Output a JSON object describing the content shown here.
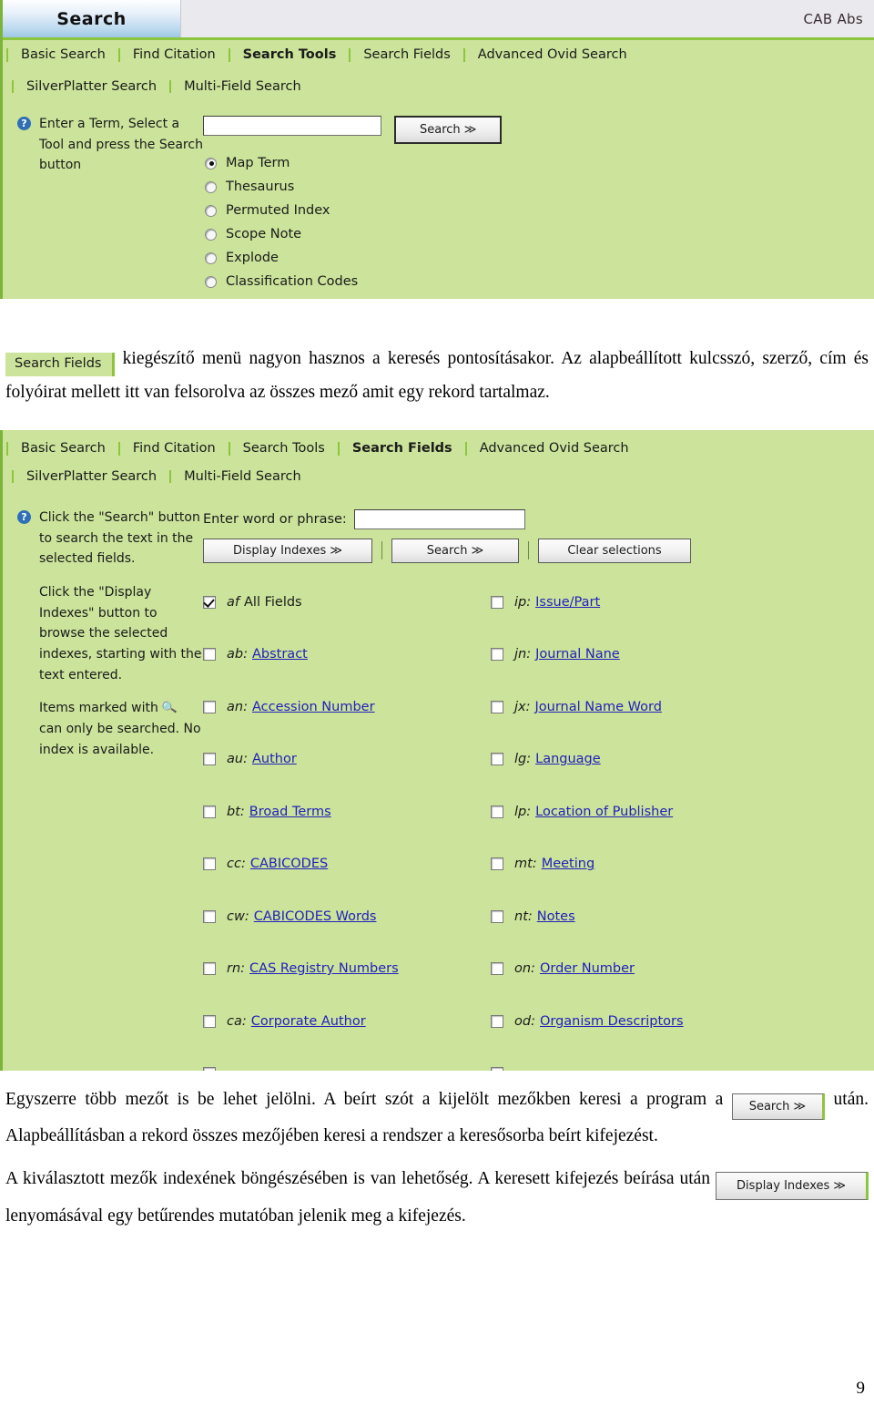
{
  "colors": {
    "panel_green": "#cbe39a",
    "accent_green": "#8cc63f",
    "link_blue": "#2222bb",
    "tab_blue": "#9ec7e6"
  },
  "screenshot1": {
    "window_tab_label": "Search",
    "database_label": "CAB Abs",
    "tabs_row1": [
      {
        "label": "Basic Search",
        "active": false
      },
      {
        "label": "Find Citation",
        "active": false
      },
      {
        "label": "Search Tools",
        "active": true
      },
      {
        "label": "Search Fields",
        "active": false
      },
      {
        "label": "Advanced Ovid Search",
        "active": false
      }
    ],
    "tabs_row2": [
      {
        "label": "SilverPlatter Search",
        "active": false
      },
      {
        "label": "Multi-Field Search",
        "active": false
      }
    ],
    "help_icon": "question-mark-icon",
    "help_text": "Enter a Term, Select a Tool and press the Search button",
    "term_input_value": "",
    "search_button_label": "Search ≫",
    "tools": [
      {
        "label": "Map Term",
        "selected": true
      },
      {
        "label": "Thesaurus",
        "selected": false
      },
      {
        "label": "Permuted Index",
        "selected": false
      },
      {
        "label": "Scope Note",
        "selected": false
      },
      {
        "label": "Explode",
        "selected": false
      },
      {
        "label": "Classification Codes",
        "selected": false
      }
    ]
  },
  "paragraph1": {
    "chip_label": "Search Fields",
    "text": " kiegészítő menü nagyon hasznos a keresés pontosításakor. Az alapbeállított kulcsszó, szerző, cím és folyóirat mellett itt van felsorolva az összes mező amit egy rekord tartalmaz."
  },
  "screenshot2": {
    "tabs_row1": [
      {
        "label": "Basic Search",
        "active": false
      },
      {
        "label": "Find Citation",
        "active": false
      },
      {
        "label": "Search Tools",
        "active": false
      },
      {
        "label": "Search Fields",
        "active": true
      },
      {
        "label": "Advanced Ovid Search",
        "active": false
      }
    ],
    "tabs_row2": [
      {
        "label": "SilverPlatter Search",
        "active": false
      },
      {
        "label": "Multi-Field Search",
        "active": false
      }
    ],
    "help_icon": "question-mark-icon",
    "help_para1": "Click the \"Search\" button to search the text in the selected fields.",
    "help_para2": "Click the \"Display Indexes\" button to browse the selected indexes, starting with the text entered.",
    "help_para3_before": "Items marked with ",
    "help_para3_icon": "magnifier-icon",
    "help_para3_after": " can only be searched. No index is available.",
    "word_label": "Enter word or phrase:",
    "word_input_value": "",
    "buttons": {
      "display_indexes": "Display Indexes ≫",
      "search": "Search ≫",
      "clear_selections": "Clear selections"
    },
    "fields_left": [
      {
        "code": "af",
        "name": "All Fields",
        "checked": true,
        "link": false
      },
      {
        "code": "ab:",
        "name": "Abstract",
        "checked": false,
        "link": true
      },
      {
        "code": "an:",
        "name": "Accession Number",
        "checked": false,
        "link": true
      },
      {
        "code": "au:",
        "name": "Author",
        "checked": false,
        "link": true
      },
      {
        "code": "bt:",
        "name": "Broad Terms",
        "checked": false,
        "link": true
      },
      {
        "code": "cc:",
        "name": "CABICODES",
        "checked": false,
        "link": true
      },
      {
        "code": "cw:",
        "name": "CABICODES Words",
        "checked": false,
        "link": true
      },
      {
        "code": "rn:",
        "name": "CAS Registry Numbers",
        "checked": false,
        "link": true
      },
      {
        "code": "ca:",
        "name": "Corporate Author",
        "checked": false,
        "link": true
      }
    ],
    "fields_right": [
      {
        "code": "ip:",
        "name": "Issue/Part",
        "checked": false,
        "link": true
      },
      {
        "code": "jn:",
        "name": "Journal Nane",
        "checked": false,
        "link": true
      },
      {
        "code": "jx:",
        "name": "Journal Name Word",
        "checked": false,
        "link": true
      },
      {
        "code": "lg:",
        "name": "Language",
        "checked": false,
        "link": true
      },
      {
        "code": "lp:",
        "name": "Location of Publisher",
        "checked": false,
        "link": true
      },
      {
        "code": "mt:",
        "name": "Meeting",
        "checked": false,
        "link": true
      },
      {
        "code": "nt:",
        "name": "Notes",
        "checked": false,
        "link": true
      },
      {
        "code": "on:",
        "name": "Order Number",
        "checked": false,
        "link": true
      },
      {
        "code": "od:",
        "name": "Organism Descriptors",
        "checked": false,
        "link": true
      }
    ]
  },
  "paragraph2": {
    "text_before_button": "Egyszerre több mezőt is be lehet jelölni. A beírt szót a kijelölt mezőkben keresi a program a ",
    "inline_button_label": "Search ≫",
    "text_after_button": " után. Alapbeállításban a rekord összes mezőjében keresi a rendszer a keresősorba beírt kifejezést."
  },
  "paragraph3": {
    "text_before_button": "A kiválasztott mezők indexének böngészésében is van lehetőség. A keresett kifejezés beírása után ",
    "inline_button_label": "Display Indexes ≫",
    "text_after_button": " lenyomásával egy betűrendes mutatóban jelenik meg a kifejezés."
  },
  "footer": {
    "page_number": "9"
  }
}
